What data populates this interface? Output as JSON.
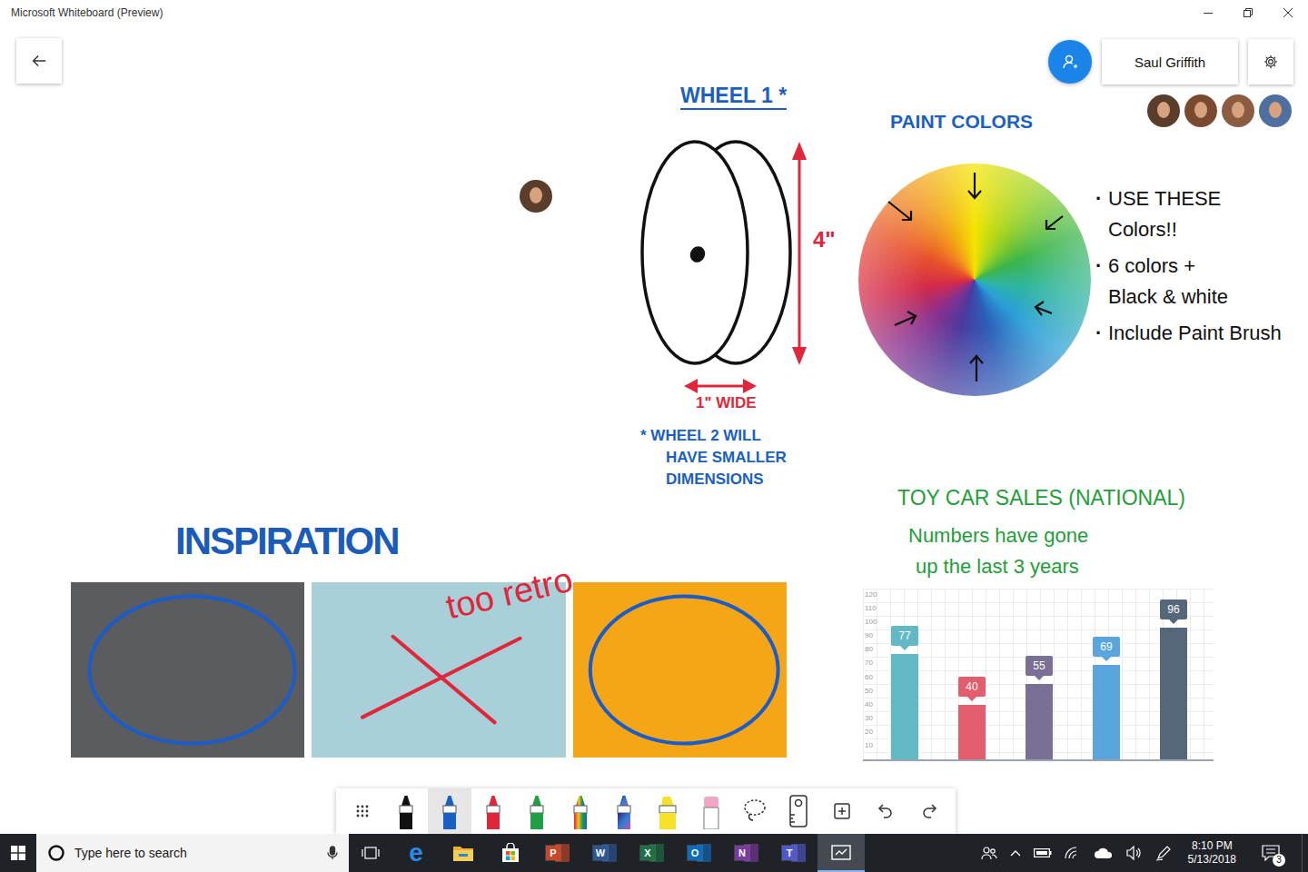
{
  "window": {
    "title": "Microsoft Whiteboard (Preview)"
  },
  "header": {
    "user": "Saul Griffith",
    "collaborators": [
      {
        "color": "#5b3d2b"
      },
      {
        "color": "#7a4a30"
      },
      {
        "color": "#8c5c40"
      },
      {
        "color": "#4f6f9f"
      }
    ]
  },
  "cursor_avatar": {
    "color": "#5b3d2b"
  },
  "wheel": {
    "title": "WHEEL 1 *",
    "height_label": "4\"",
    "width_label": "1\" WIDE",
    "note": [
      "* WHEEL 2 WILL",
      "HAVE SMALLER",
      "DIMENSIONS"
    ]
  },
  "paint": {
    "title": "PAINT COLORS",
    "notes": [
      {
        "bullet": "·",
        "lines": [
          "USE THESE",
          "Colors!!"
        ]
      },
      {
        "bullet": "·",
        "lines": [
          "6 colors +",
          "Black & white"
        ]
      },
      {
        "bullet": "·",
        "lines": [
          "Include Paint Brush"
        ]
      }
    ]
  },
  "inspiration": {
    "title": "INSPIRATION",
    "annotation": "too retro",
    "images": [
      {
        "kind": "circled",
        "color": "#5a5c60",
        "mark_color": "#1b5cc9"
      },
      {
        "kind": "crossed",
        "color": "#a9cfd9",
        "mark_color": "#e0263a"
      },
      {
        "kind": "circled",
        "color": "#f5a617",
        "mark_color": "#1b5cc9"
      }
    ]
  },
  "sales": {
    "title": "TOY CAR SALES (NATIONAL)",
    "note": [
      "Numbers have gone",
      "up the last 3 years"
    ],
    "chart": {
      "ticks": [
        "120",
        "110",
        "100",
        "90",
        "80",
        "70",
        "60",
        "50",
        "40",
        "30",
        "20",
        "10"
      ],
      "values": [
        77,
        40,
        55,
        69,
        96
      ],
      "labels": [
        "77",
        "40",
        "55",
        "69",
        "96"
      ],
      "colors": [
        "#62b8c4",
        "#e25d6d",
        "#7a7096",
        "#5aa5dd",
        "#56677a"
      ]
    }
  },
  "toolbar": {
    "tools": [
      {
        "kind": "grid",
        "selected": false
      },
      {
        "kind": "pen",
        "color": "#111111",
        "selected": false
      },
      {
        "kind": "pen",
        "color": "#1a5fc4",
        "selected": true
      },
      {
        "kind": "pen",
        "color": "#e0263a",
        "selected": false
      },
      {
        "kind": "pen",
        "color": "#1f9e45",
        "selected": false
      },
      {
        "kind": "rainbow-pen",
        "selected": false
      },
      {
        "kind": "galaxy-pen",
        "selected": false
      },
      {
        "kind": "highlighter",
        "color": "#f7e12b",
        "selected": false
      },
      {
        "kind": "eraser",
        "color": "#f2a6c5",
        "selected": false
      },
      {
        "kind": "lasso",
        "selected": false
      },
      {
        "kind": "ruler",
        "selected": false
      },
      {
        "kind": "add",
        "selected": false
      },
      {
        "kind": "undo",
        "selected": false
      },
      {
        "kind": "redo",
        "selected": false
      }
    ]
  },
  "taskbar": {
    "search": {
      "placeholder": "Type here to search"
    },
    "apps": [
      {
        "kind": "task-view",
        "selected": false
      },
      {
        "kind": "edge",
        "glyph": "e",
        "color": "#2a8ae8",
        "selected": false
      },
      {
        "kind": "explorer",
        "selected": false
      },
      {
        "kind": "store",
        "selected": false
      },
      {
        "kind": "office",
        "glyph": "P",
        "color": "#c8472a",
        "selected": false
      },
      {
        "kind": "office",
        "glyph": "W",
        "color": "#2b5797",
        "selected": false
      },
      {
        "kind": "office",
        "glyph": "X",
        "color": "#1e7145",
        "selected": false
      },
      {
        "kind": "office",
        "glyph": "O",
        "color": "#0f6cbd",
        "selected": false
      },
      {
        "kind": "office",
        "glyph": "N",
        "color": "#7b3aa0",
        "selected": false
      },
      {
        "kind": "office",
        "glyph": "T",
        "color": "#5059c9",
        "selected": false
      },
      {
        "kind": "whiteboard",
        "selected": true
      }
    ],
    "clock": {
      "time": "8:10 PM",
      "date": "5/13/2018"
    },
    "notifications": "3"
  }
}
